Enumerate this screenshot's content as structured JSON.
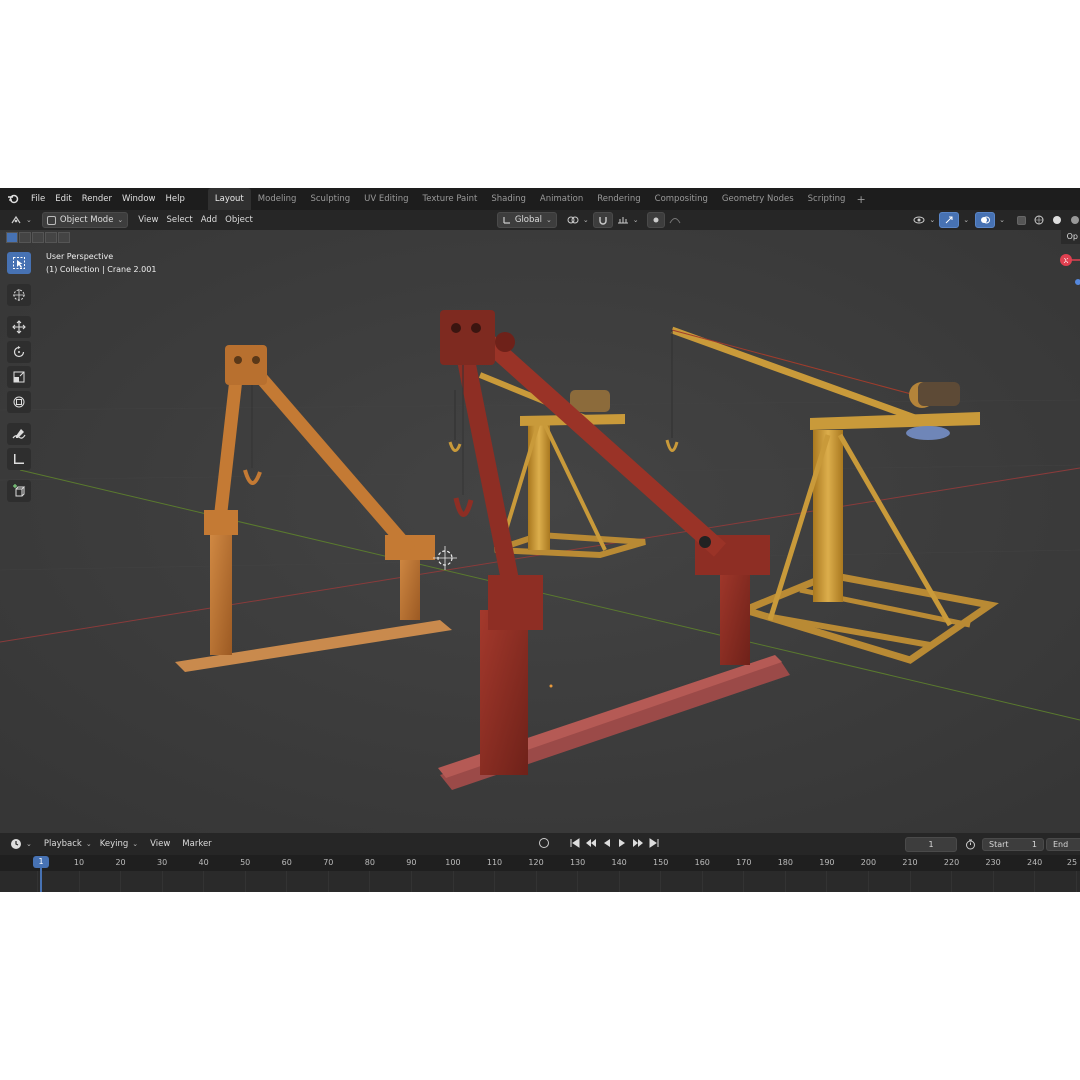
{
  "menu": {
    "items": [
      "File",
      "Edit",
      "Render",
      "Window",
      "Help"
    ]
  },
  "workspaces": {
    "tabs": [
      "Layout",
      "Modeling",
      "Sculpting",
      "UV Editing",
      "Texture Paint",
      "Shading",
      "Animation",
      "Rendering",
      "Compositing",
      "Geometry Nodes",
      "Scripting"
    ],
    "active": "Layout",
    "add_symbol": "+"
  },
  "header": {
    "mode": "Object Mode",
    "menus": [
      "View",
      "Select",
      "Add",
      "Object"
    ],
    "transform_orientation": "Global",
    "right_panel_label": "Op"
  },
  "viewport": {
    "perspective": "User Perspective",
    "collection": "(1) Collection | Crane 2.001"
  },
  "timeline": {
    "menus": [
      "Playback",
      "Keying",
      "View",
      "Marker"
    ],
    "current_frame": "1",
    "start_label": "Start",
    "start_value": "1",
    "end_label": "End",
    "marker_frame": "1",
    "ticks": [
      "10",
      "20",
      "30",
      "40",
      "50",
      "60",
      "70",
      "80",
      "90",
      "100",
      "110",
      "120",
      "130",
      "140",
      "150",
      "160",
      "170",
      "180",
      "190",
      "200",
      "210",
      "220",
      "230",
      "240",
      "25"
    ]
  },
  "icons": {
    "tools": [
      "select-box-icon",
      "cursor-icon",
      "move-icon",
      "rotate-icon",
      "scale-icon",
      "transform-icon",
      "annotate-icon",
      "measure-icon",
      "add-cube-icon"
    ]
  },
  "colors": {
    "accent": "#4772b3",
    "red_crane": "#8e2e24",
    "orange_crane": "#c47a34",
    "yellow_crane": "#c99a3a"
  }
}
